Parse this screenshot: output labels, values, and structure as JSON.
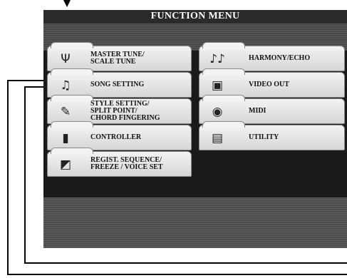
{
  "title": "FUNCTION MENU",
  "left_items": [
    {
      "label": "MASTER TUNE/\nSCALE TUNE",
      "icon": "tuning-fork-icon",
      "glyph": "Ψ"
    },
    {
      "label": "SONG SETTING",
      "icon": "music-note-icon",
      "glyph": "♫"
    },
    {
      "label": "STYLE SETTING/\nSPLIT POINT/\nCHORD FINGERING",
      "icon": "style-instruments-icon",
      "glyph": "✎"
    },
    {
      "label": "CONTROLLER",
      "icon": "pedal-controller-icon",
      "glyph": "▮"
    },
    {
      "label": "REGIST. SEQUENCE/\nFREEZE / VOICE SET",
      "icon": "registration-icon",
      "glyph": "◩"
    }
  ],
  "right_items": [
    {
      "label": "HARMONY/ECHO",
      "icon": "harmony-notes-icon",
      "glyph": "♪♪"
    },
    {
      "label": "VIDEO OUT",
      "icon": "video-monitor-icon",
      "glyph": "▣"
    },
    {
      "label": "MIDI",
      "icon": "midi-port-icon",
      "glyph": "◉"
    },
    {
      "label": "UTILITY",
      "icon": "utility-keyboard-icon",
      "glyph": "▤"
    }
  ]
}
